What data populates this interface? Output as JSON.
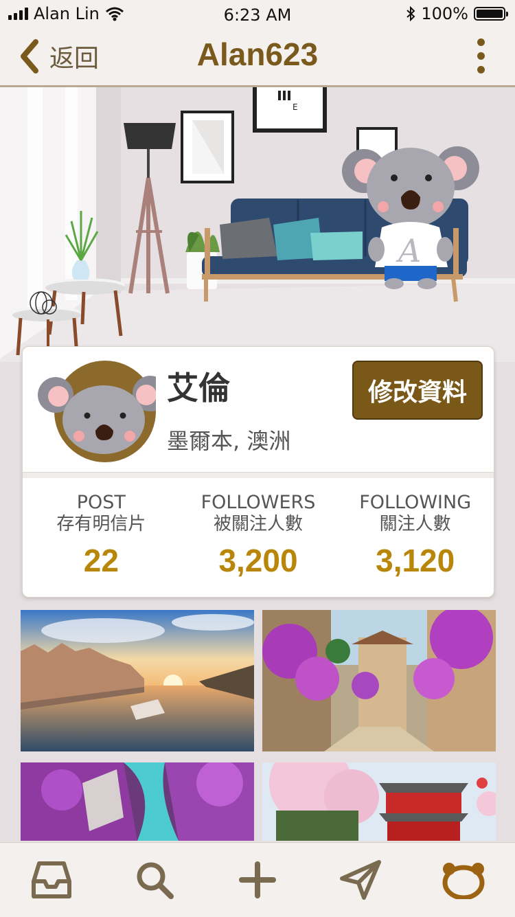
{
  "status": {
    "carrier": "Alan Lin",
    "time": "6:23 AM",
    "battery": "100%",
    "battery_level": 1.0
  },
  "nav": {
    "back_label": "返回",
    "title": "Alan623"
  },
  "profile": {
    "name": "艾倫",
    "location": "墨爾本, 澳洲",
    "edit_label": "修改資料",
    "shirt_letter": "A",
    "poster_text": "E"
  },
  "stats": [
    {
      "en": "POST",
      "zh": "存有明信片",
      "value": "22"
    },
    {
      "en": "FOLLOWERS",
      "zh": "被關注人數",
      "value": "3,200"
    },
    {
      "en": "FOLLOWING",
      "zh": "關注人數",
      "value": "3,120"
    }
  ],
  "photos": [
    "paris-river-photo",
    "flower-village-photo",
    "purple-canyon-photo",
    "cherry-temple-photo"
  ],
  "tabs": [
    "inbox-icon",
    "search-icon",
    "add-icon",
    "send-icon",
    "profile-bear-icon"
  ],
  "colors": {
    "accent": "#7a5a1c",
    "stat_number": "#b8860b",
    "button": "#7a5818",
    "background": "#e5dfe1"
  }
}
